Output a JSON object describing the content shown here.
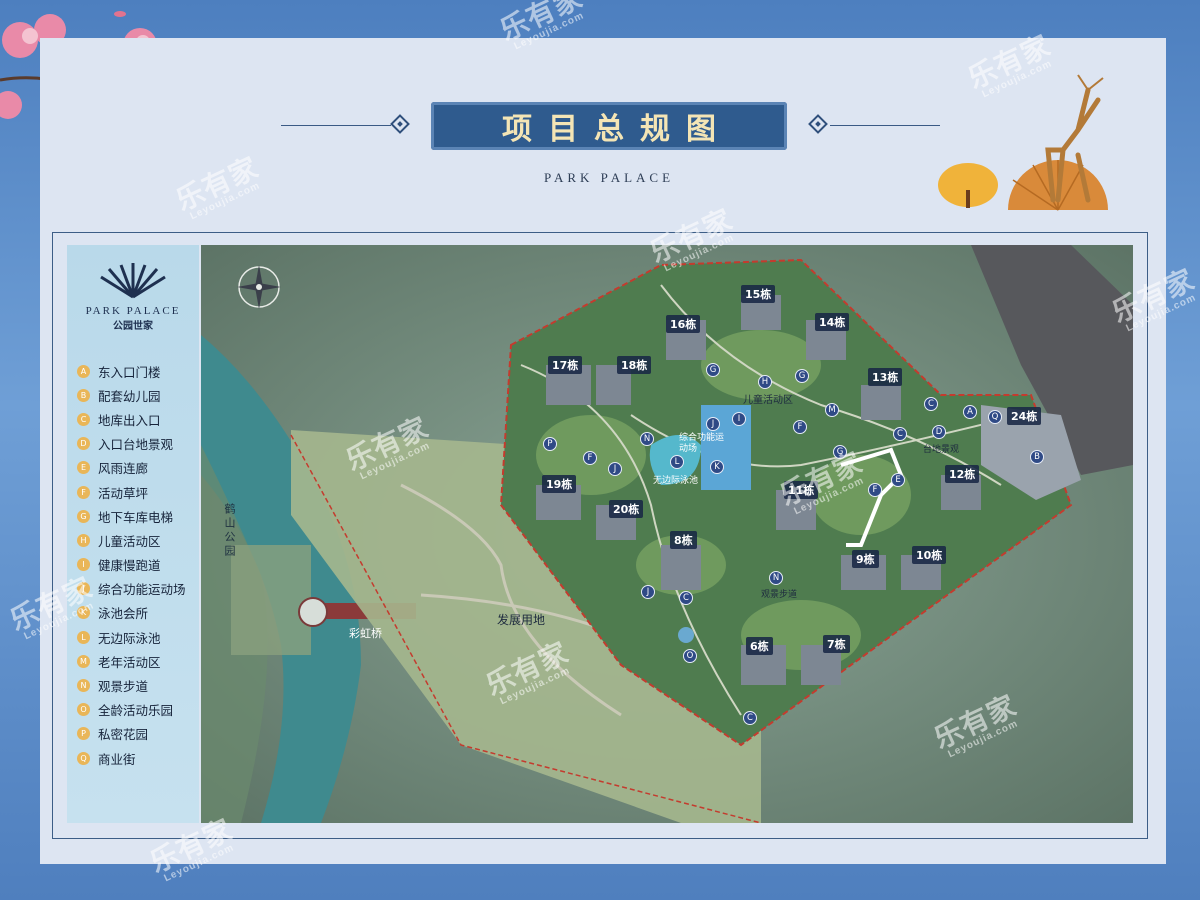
{
  "header": {
    "title": "项目总规图",
    "subtitle": "PARK PALACE"
  },
  "logo": {
    "en": "PARK PALACE",
    "cn": "公园世家",
    "icon": "fan-logo-icon"
  },
  "legend": [
    {
      "key": "A",
      "label": "东入口门楼"
    },
    {
      "key": "B",
      "label": "配套幼儿园"
    },
    {
      "key": "C",
      "label": "地库出入口"
    },
    {
      "key": "D",
      "label": "入口台地景观"
    },
    {
      "key": "E",
      "label": "风雨连廊"
    },
    {
      "key": "F",
      "label": "活动草坪"
    },
    {
      "key": "G",
      "label": "地下车库电梯"
    },
    {
      "key": "H",
      "label": "儿童活动区"
    },
    {
      "key": "I",
      "label": "健康慢跑道"
    },
    {
      "key": "J",
      "label": "综合功能运动场"
    },
    {
      "key": "K",
      "label": "泳池会所"
    },
    {
      "key": "L",
      "label": "无边际泳池"
    },
    {
      "key": "M",
      "label": "老年活动区"
    },
    {
      "key": "N",
      "label": "观景步道"
    },
    {
      "key": "O",
      "label": "全龄活动乐园"
    },
    {
      "key": "P",
      "label": "私密花园"
    },
    {
      "key": "Q",
      "label": "商业街"
    }
  ],
  "buildings": [
    "15栋",
    "16栋",
    "14栋",
    "17栋",
    "18栋",
    "13栋",
    "24栋",
    "12栋",
    "19栋",
    "20栋",
    "11栋",
    "8栋",
    "9栋",
    "10栋",
    "6栋",
    "7栋"
  ],
  "facility_markers": [
    "G",
    "H",
    "G",
    "M",
    "J",
    "I",
    "F",
    "G",
    "C",
    "C",
    "A",
    "Q",
    "D",
    "B",
    "P",
    "F",
    "J",
    "N",
    "K",
    "L",
    "E",
    "F",
    "C",
    "J",
    "N",
    "O",
    "C"
  ],
  "map_labels": {
    "children_area": "儿童活动区",
    "sports_field": "综合功能运动场",
    "infinity_pool": "无边际泳池",
    "terrace": "台地景观",
    "viewing_path": "观景步道",
    "dev_land": "发展用地",
    "rainbow_bridge": "彩虹桥",
    "heshan_park": "鹤山公园"
  },
  "watermark": {
    "cn": "乐有家",
    "en": "Leyoujia.com"
  },
  "colors": {
    "title_box": "#2f5b8e",
    "title_text": "#f4e5b5",
    "legend_badge": "#e9b658",
    "marker": "#2f4a86",
    "boundary": "#c43b2e",
    "water": "#3f8a8e"
  }
}
